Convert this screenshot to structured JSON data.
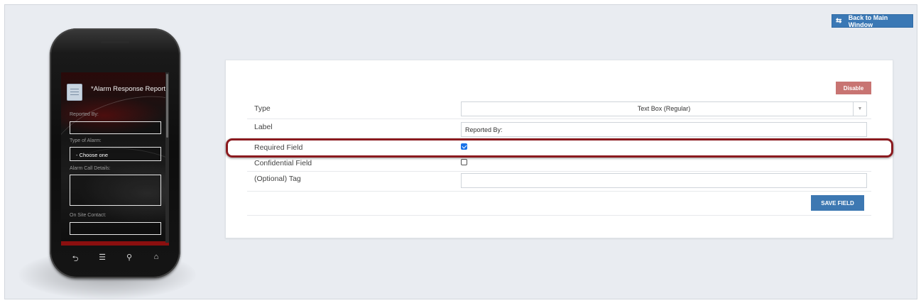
{
  "header": {
    "back_label": "Back to Main Window",
    "back_icon": "exchange-arrows-icon"
  },
  "phone": {
    "form_title": "*Alarm Response Report",
    "fields": [
      {
        "label": "Reported By:",
        "kind": "input",
        "value": ""
      },
      {
        "label": "Type of Alarm:",
        "kind": "select",
        "value": "- Choose one"
      },
      {
        "label": "Alarm Call Details:",
        "kind": "textarea",
        "value": ""
      },
      {
        "label": "On Site Contact:",
        "kind": "input",
        "value": ""
      }
    ],
    "nav_icons": [
      "back-icon",
      "menu-icon",
      "search-icon",
      "home-icon"
    ]
  },
  "editor": {
    "disable_label": "Disable",
    "type": {
      "label": "Type",
      "value": "Text Box (Regular)"
    },
    "label_field": {
      "label": "Label",
      "value": "Reported By:"
    },
    "required": {
      "label": "Required Field",
      "checked": true
    },
    "confidential": {
      "label": "Confidential Field",
      "checked": false
    },
    "tag": {
      "label": "(Optional) Tag",
      "value": ""
    },
    "save_label": "SAVE FIELD"
  },
  "colors": {
    "accent": "#3a78b5",
    "danger": "#c87472",
    "highlight": "#8b1a1f"
  }
}
